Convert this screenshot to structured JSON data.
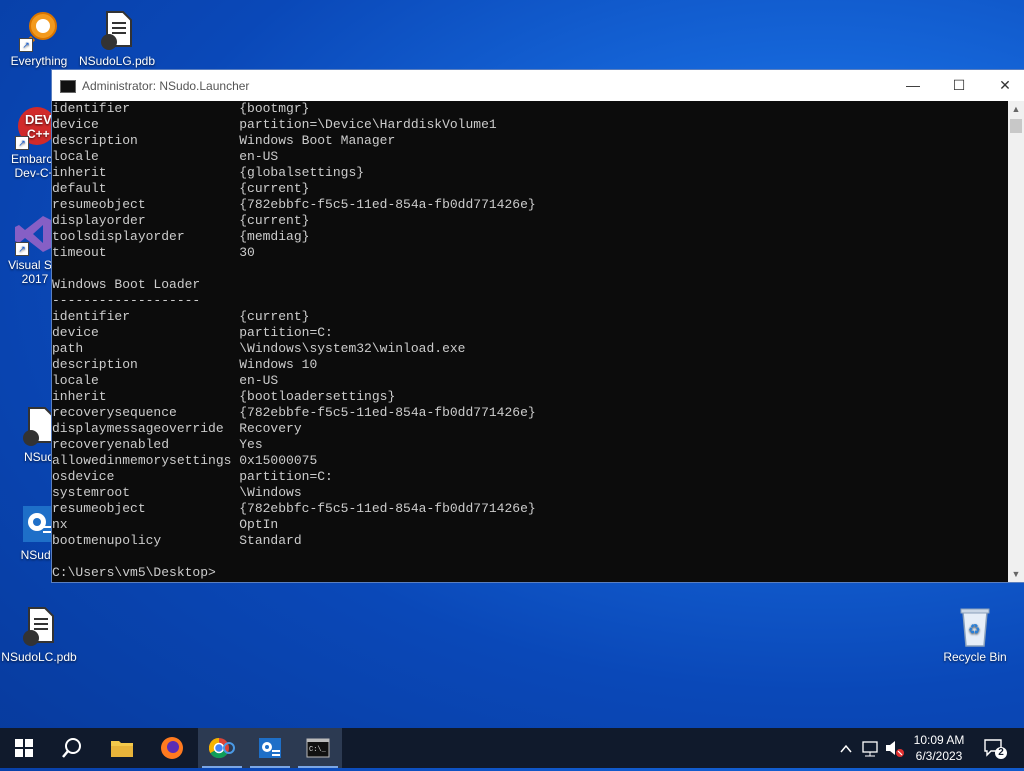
{
  "desktop": {
    "icons": [
      {
        "label": "Everything"
      },
      {
        "label": "NSudoLG.pdb"
      },
      {
        "label": "Embarca"
      },
      {
        "label": "Dev-C+"
      },
      {
        "label": "Visual Stu"
      },
      {
        "label": "2017"
      },
      {
        "label": "NSud"
      },
      {
        "label": "NSudo"
      },
      {
        "label": "NSudoLC.pdb"
      },
      {
        "label": "Recycle Bin"
      }
    ]
  },
  "window": {
    "title": "Administrator: NSudo.Launcher",
    "minimize": "—",
    "maximize": "☐",
    "close": "✕",
    "console_lines": [
      "identifier              {bootmgr}",
      "device                  partition=\\Device\\HarddiskVolume1",
      "description             Windows Boot Manager",
      "locale                  en-US",
      "inherit                 {globalsettings}",
      "default                 {current}",
      "resumeobject            {782ebbfc-f5c5-11ed-854a-fb0dd771426e}",
      "displayorder            {current}",
      "toolsdisplayorder       {memdiag}",
      "timeout                 30",
      "",
      "Windows Boot Loader",
      "-------------------",
      "identifier              {current}",
      "device                  partition=C:",
      "path                    \\Windows\\system32\\winload.exe",
      "description             Windows 10",
      "locale                  en-US",
      "inherit                 {bootloadersettings}",
      "recoverysequence        {782ebbfe-f5c5-11ed-854a-fb0dd771426e}",
      "displaymessageoverride  Recovery",
      "recoveryenabled         Yes",
      "allowedinmemorysettings 0x15000075",
      "osdevice                partition=C:",
      "systemroot              \\Windows",
      "resumeobject            {782ebbfc-f5c5-11ed-854a-fb0dd771426e}",
      "nx                      OptIn",
      "bootmenupolicy          Standard",
      "",
      "C:\\Users\\vm5\\Desktop>"
    ]
  },
  "taskbar": {
    "clock_time": "10:09 AM",
    "clock_date": "6/3/2023",
    "notification_count": "2"
  }
}
